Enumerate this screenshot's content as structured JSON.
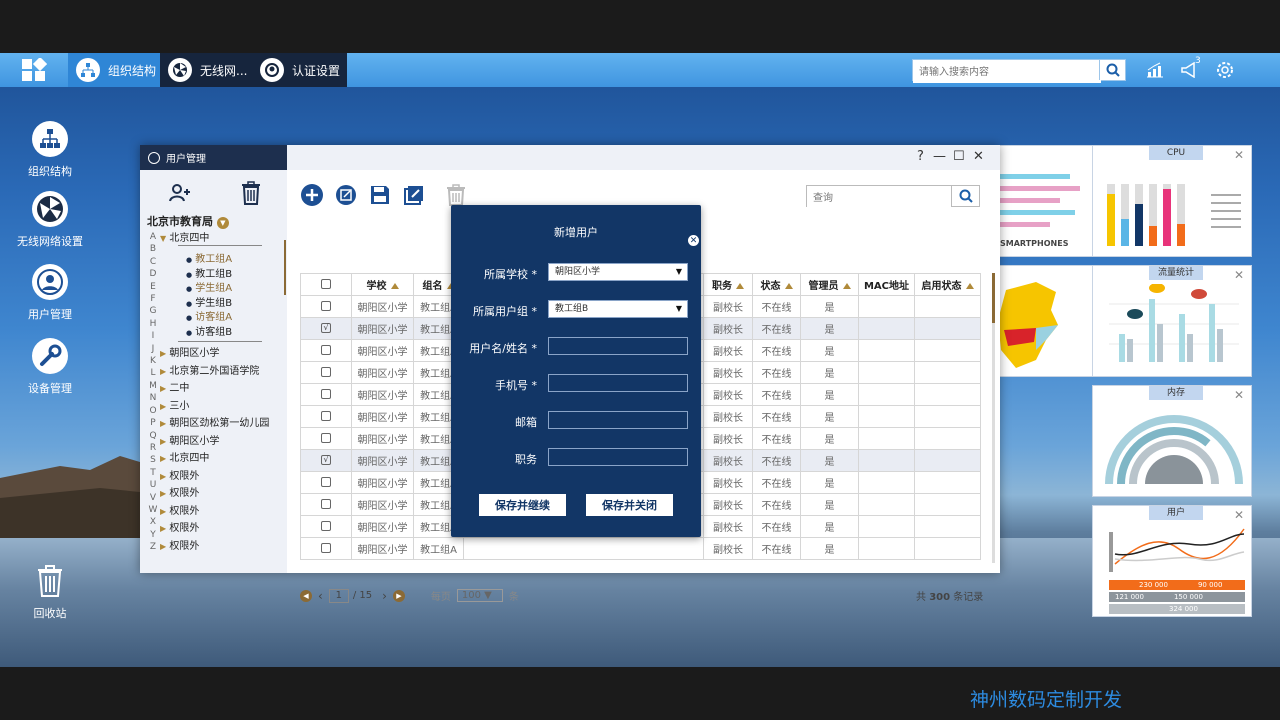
{
  "taskbar": {
    "tabs": [
      {
        "label": "组织结构"
      },
      {
        "label": "无线网..."
      },
      {
        "label": "认证设置"
      }
    ],
    "search_placeholder": "请输入搜索内容",
    "notif_count": "3"
  },
  "desktop_icons": [
    {
      "label": "组织结构"
    },
    {
      "label": "无线网络设置"
    },
    {
      "label": "用户管理"
    },
    {
      "label": "设备管理"
    },
    {
      "label": "回收站"
    }
  ],
  "window": {
    "title": "用户管理",
    "controls": {
      "help": "?",
      "min": "—",
      "max": "☐",
      "close": "✕"
    },
    "tree": {
      "root": "北京市教育局",
      "node1": "北京四中",
      "children": [
        "教工组A",
        "教工组B",
        "学生组A",
        "学生组B",
        "访客组A",
        "访客组B"
      ],
      "others": [
        "朝阳区小学",
        "北京第二外国语学院",
        "二中",
        "三小",
        "朝阳区劲松第一幼儿园",
        "朝阳区小学",
        "北京四中",
        "权限外",
        "权限外",
        "权限外",
        "权限外",
        "权限外"
      ]
    },
    "alphabet": [
      "A",
      "B",
      "C",
      "D",
      "E",
      "F",
      "G",
      "H",
      "I",
      "J",
      "K",
      "L",
      "M",
      "N",
      "O",
      "P",
      "Q",
      "R",
      "S",
      "T",
      "U",
      "V",
      "W",
      "X",
      "Y",
      "Z"
    ],
    "search_placeholder": "查询",
    "columns": [
      "学校",
      "组名",
      "",
      "职务",
      "状态",
      "管理员",
      "MAC地址",
      "启用状态"
    ],
    "rows": [
      {
        "school": "朝阳区小学",
        "group": "教工组A",
        "duty": "副校长",
        "status": "不在线",
        "admin": "是",
        "checked": "",
        "hl": false
      },
      {
        "school": "朝阳区小学",
        "group": "教工组A",
        "duty": "副校长",
        "status": "不在线",
        "admin": "是",
        "checked": "√",
        "hl": true
      },
      {
        "school": "朝阳区小学",
        "group": "教工组A",
        "duty": "副校长",
        "status": "不在线",
        "admin": "是",
        "checked": "",
        "hl": false
      },
      {
        "school": "朝阳区小学",
        "group": "教工组A",
        "duty": "副校长",
        "status": "不在线",
        "admin": "是",
        "checked": "",
        "hl": false
      },
      {
        "school": "朝阳区小学",
        "group": "教工组A",
        "duty": "副校长",
        "status": "不在线",
        "admin": "是",
        "checked": "",
        "hl": false
      },
      {
        "school": "朝阳区小学",
        "group": "教工组A",
        "duty": "副校长",
        "status": "不在线",
        "admin": "是",
        "checked": "",
        "hl": false
      },
      {
        "school": "朝阳区小学",
        "group": "教工组A",
        "duty": "副校长",
        "status": "不在线",
        "admin": "是",
        "checked": "",
        "hl": false
      },
      {
        "school": "朝阳区小学",
        "group": "教工组A",
        "duty": "副校长",
        "status": "不在线",
        "admin": "是",
        "checked": "√",
        "hl": true
      },
      {
        "school": "朝阳区小学",
        "group": "教工组A",
        "duty": "副校长",
        "status": "不在线",
        "admin": "是",
        "checked": "",
        "hl": false
      },
      {
        "school": "朝阳区小学",
        "group": "教工组A",
        "duty": "副校长",
        "status": "不在线",
        "admin": "是",
        "checked": "",
        "hl": false
      },
      {
        "school": "朝阳区小学",
        "group": "教工组A",
        "duty": "副校长",
        "status": "不在线",
        "admin": "是",
        "checked": "",
        "hl": false
      },
      {
        "school": "朝阳区小学",
        "group": "教工组A",
        "duty": "副校长",
        "status": "不在线",
        "admin": "是",
        "checked": "",
        "hl": false
      }
    ],
    "pager": {
      "page": "1",
      "total_pages": "/ 15",
      "per_page_label": "每页",
      "per_page": "100",
      "unit": "条",
      "total_prefix": "共",
      "total": "300",
      "total_suffix": "条记录"
    }
  },
  "modal": {
    "title": "新增用户",
    "close": "✕",
    "fields": [
      {
        "label": "所属学校",
        "required": "*",
        "value": "朝阳区小学"
      },
      {
        "label": "所属用户组",
        "required": "*",
        "value": "教工组B"
      },
      {
        "label": "用户名/姓名",
        "required": "*",
        "value": ""
      },
      {
        "label": "手机号",
        "required": "*",
        "value": ""
      },
      {
        "label": "邮箱",
        "required": "",
        "value": ""
      },
      {
        "label": "职务",
        "required": "",
        "value": ""
      }
    ],
    "btn_continue": "保存并继续",
    "btn_close": "保存并关闭"
  },
  "widgets": {
    "w1": "",
    "cpu": "CPU",
    "w3": "",
    "traffic": "流量统计",
    "mem": "内存",
    "user": "用户"
  },
  "user_widget": {
    "v1": "230 000",
    "v2": "90 000",
    "v3": "121 000",
    "v4": "150 000",
    "v5": "324 000"
  },
  "footer": "神州数码定制开发",
  "colors": {
    "taskbar": "#4fa6ea",
    "modal": "#123666",
    "sidebar_title": "#1d2f4e",
    "accent_gold": "#b08a3a"
  }
}
